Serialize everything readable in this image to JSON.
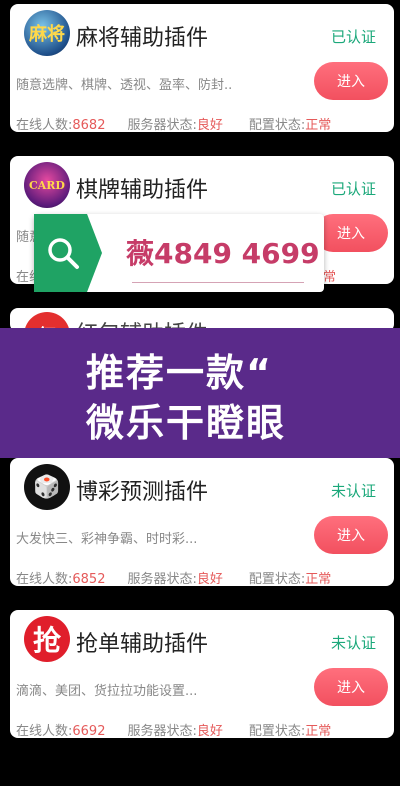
{
  "cards": [
    {
      "title": "麻将辅助插件",
      "status": "已认证",
      "description": "随意选牌、棋牌、透视、盈率、防封..",
      "button": "进入",
      "online_label": "在线人数:",
      "online_value": "8682",
      "server_label": "服务器状态:",
      "server_value": "良好",
      "config_label": "配置状态:",
      "config_value": "正常",
      "logo_text": "麻将"
    },
    {
      "title": "棋牌辅助插件",
      "status": "已认证",
      "description": "随意",
      "button": "进入",
      "online_label": "在线",
      "config_value": "正常",
      "logo_text": "CARD"
    },
    {
      "title": "红包辅助插件",
      "logo_text": "红"
    },
    {
      "title": "博彩预测插件",
      "status": "未认证",
      "description": "大发快三、彩神争霸、时时彩...",
      "button": "进入",
      "online_label": "在线人数:",
      "online_value": "6852",
      "server_label": "服务器状态:",
      "server_value": "良好",
      "config_label": "配置状态:",
      "config_value": "正常",
      "logo_text": "🎲"
    },
    {
      "title": "抢单辅助插件",
      "status": "未认证",
      "description": "滴滴、美团、货拉拉功能设置...",
      "button": "进入",
      "online_label": "在线人数:",
      "online_value": "6692",
      "server_label": "服务器状态:",
      "server_value": "良好",
      "config_label": "配置状态:",
      "config_value": "正常",
      "logo_text": "抢"
    }
  ],
  "search_overlay": {
    "text": "薇4849 4699",
    "icon": "search-icon",
    "accent": "#1fa364"
  },
  "banner": {
    "line1": "推荐一款“",
    "line2": "微乐干瞪眼"
  }
}
